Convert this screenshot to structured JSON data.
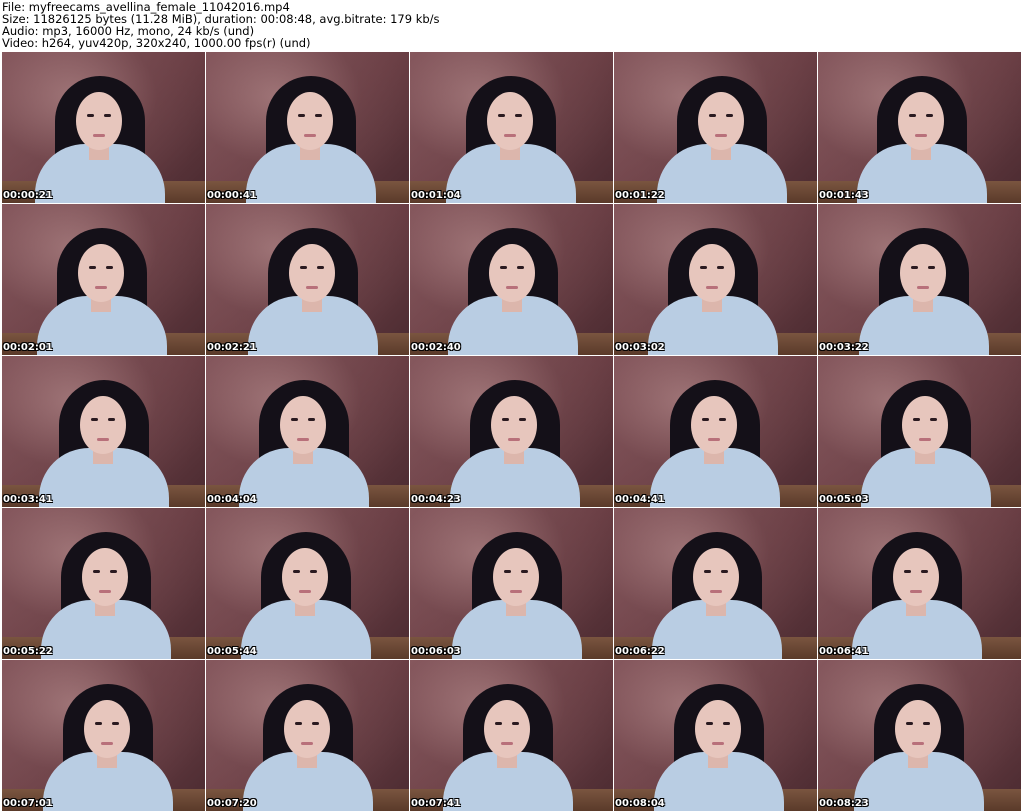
{
  "header": {
    "file_line": "File: myfreecams_avellina_female_11042016.mp4",
    "size_line": "Size: 11826125 bytes (11.28 MiB), duration: 00:08:48, avg.bitrate: 179 kb/s",
    "audio_line": "Audio: mp3, 16000 Hz, mono, 24 kb/s (und)",
    "video_line": "Video: h264, yuv420p, 320x240, 1000.00 fps(r) (und)"
  },
  "thumbnails": [
    {
      "timestamp": "00:00:21"
    },
    {
      "timestamp": "00:00:41"
    },
    {
      "timestamp": "00:01:04"
    },
    {
      "timestamp": "00:01:22"
    },
    {
      "timestamp": "00:01:43"
    },
    {
      "timestamp": "00:02:01"
    },
    {
      "timestamp": "00:02:21"
    },
    {
      "timestamp": "00:02:40"
    },
    {
      "timestamp": "00:03:02"
    },
    {
      "timestamp": "00:03:22"
    },
    {
      "timestamp": "00:03:41"
    },
    {
      "timestamp": "00:04:04"
    },
    {
      "timestamp": "00:04:23"
    },
    {
      "timestamp": "00:04:41"
    },
    {
      "timestamp": "00:05:03"
    },
    {
      "timestamp": "00:05:22"
    },
    {
      "timestamp": "00:05:44"
    },
    {
      "timestamp": "00:06:03"
    },
    {
      "timestamp": "00:06:22"
    },
    {
      "timestamp": "00:06:41"
    },
    {
      "timestamp": "00:07:01"
    },
    {
      "timestamp": "00:07:20"
    },
    {
      "timestamp": "00:07:41"
    },
    {
      "timestamp": "00:08:04"
    },
    {
      "timestamp": "00:08:23"
    }
  ]
}
